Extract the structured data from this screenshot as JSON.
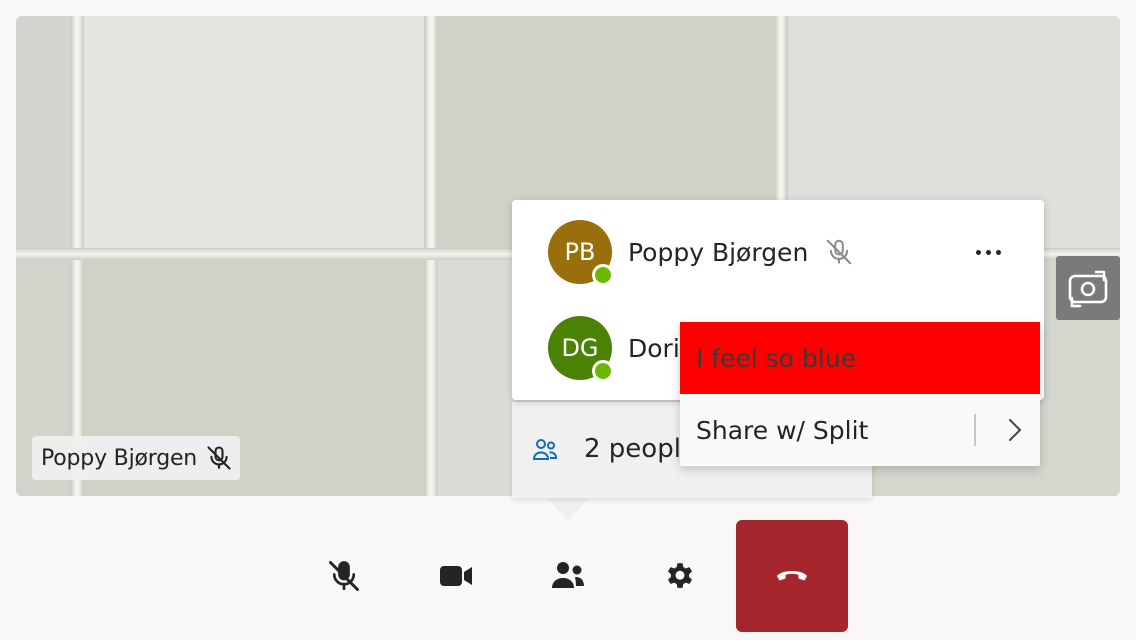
{
  "video": {
    "participant_name": "Poppy Bjørgen",
    "mic_state_icon": "mic-off-icon",
    "camera_switch_icon": "camera-switch-icon"
  },
  "people_panel": {
    "participants": [
      {
        "initials": "PB",
        "name": "Poppy Bjørgen",
        "avatar_color": "#986f0b",
        "presence": "available",
        "mic_icon": "mic-off-icon"
      },
      {
        "initials": "DG",
        "name": "Dori",
        "avatar_color": "#498205",
        "presence": "available"
      }
    ],
    "more_options_icon": "more-horizontal-icon",
    "people_count_label": "2 peopl",
    "people_icon": "people-icon"
  },
  "context_menu": {
    "items": [
      {
        "label": "I feel so blue",
        "background": "#ff0000"
      },
      {
        "label": "Share w/ Split",
        "submenu_icon": "chevron-right-icon"
      }
    ]
  },
  "controls": {
    "buttons": [
      {
        "name": "mute",
        "icon": "mic-off-icon"
      },
      {
        "name": "camera",
        "icon": "video-camera-icon"
      },
      {
        "name": "people",
        "icon": "people-icon"
      },
      {
        "name": "settings",
        "icon": "gear-icon"
      },
      {
        "name": "hang-up",
        "icon": "phone-hangup-icon",
        "background": "#a4262c"
      }
    ]
  },
  "colors": {
    "presence_available": "#6bb700",
    "hangup": "#a4262c",
    "accent": "#0078d4"
  }
}
